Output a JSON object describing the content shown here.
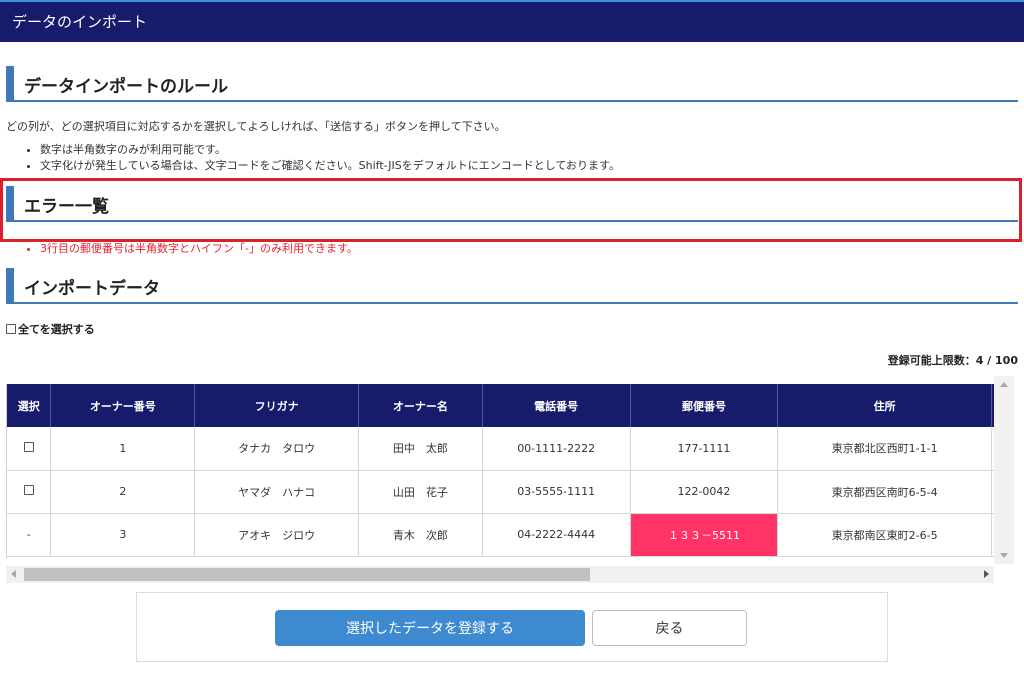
{
  "header": {
    "title": "データのインポート"
  },
  "rules_section": {
    "heading": "データインポートのルール",
    "intro": "どの列が、どの選択項目に対応するかを選択してよろしければ、「送信する」ボタンを押して下さい。",
    "items": [
      "数字は半角数字のみが利用可能です。",
      "文字化けが発生している場合は、文字コードをご確認ください。Shift-JISをデフォルトにエンコードとしております。"
    ]
  },
  "error_section": {
    "heading": "エラー一覧",
    "items": [
      "3行目の郵便番号は半角数字とハイフン「-」のみ利用できます。"
    ],
    "border_color": "#d9202b",
    "text_color": "#e8222f"
  },
  "import_section": {
    "heading": "インポートデータ",
    "select_all_label": "全てを選択する",
    "limit_label": "登録可能上限数：4 / 100"
  },
  "table": {
    "columns": [
      "選択",
      "オーナー番号",
      "フリガナ",
      "オーナー名",
      "電話番号",
      "郵便番号",
      "住所"
    ],
    "rows": [
      {
        "select": "checkbox",
        "owner_no": "1",
        "kana": "タナカ　タロウ",
        "name": "田中　太郎",
        "phone": "00-1111-2222",
        "postal": "177-1111",
        "address": "東京都北区西町1-1-1",
        "postal_error": false
      },
      {
        "select": "checkbox",
        "owner_no": "2",
        "kana": "ヤマダ　ハナコ",
        "name": "山田　花子",
        "phone": "03-5555-1111",
        "postal": "122-0042",
        "address": "東京都西区南町6-5-4",
        "postal_error": false
      },
      {
        "select": "-",
        "owner_no": "3",
        "kana": "アオキ　ジロウ",
        "name": "青木　次郎",
        "phone": "04-2222-4444",
        "postal": "１３３－5511",
        "address": "東京都南区東町2-6-5",
        "postal_error": true
      }
    ],
    "header_color": "#161b6b",
    "error_cell_color": "#ff3366"
  },
  "actions": {
    "register_label": "選択したデータを登録する",
    "back_label": "戻る",
    "primary_color": "#3e8ad0"
  }
}
